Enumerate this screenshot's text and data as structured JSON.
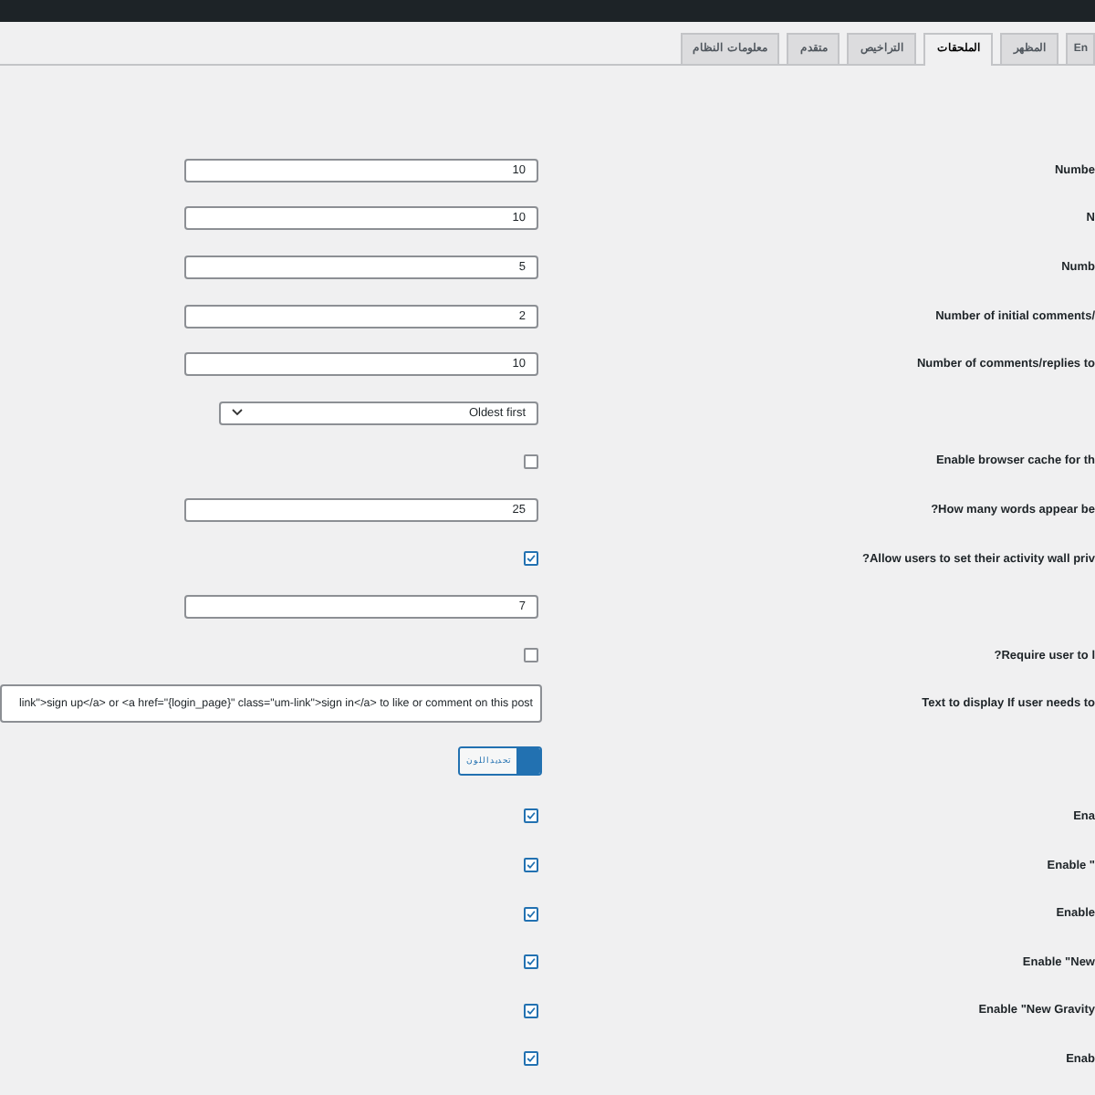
{
  "tabs": [
    {
      "label": "En",
      "selected": false
    },
    {
      "label": "المظهر",
      "selected": false
    },
    {
      "label": "الملحقات",
      "selected": true
    },
    {
      "label": "التراخيص",
      "selected": false
    },
    {
      "label": "متقدم",
      "selected": false
    },
    {
      "label": "معلومات النظام",
      "selected": false
    }
  ],
  "settings": [
    {
      "kind": "number",
      "label": "Numbe",
      "value": "10"
    },
    {
      "kind": "number",
      "label": "N",
      "value": "10"
    },
    {
      "kind": "number",
      "label": "Numb",
      "value": "5"
    },
    {
      "kind": "number",
      "label": "Number of initial comments/",
      "value": "2"
    },
    {
      "kind": "number",
      "label": "Number of comments/replies to",
      "value": "10"
    },
    {
      "kind": "select",
      "value": "Oldest first"
    },
    {
      "kind": "checkbox",
      "label": "Enable browser cache for th",
      "checked": false
    },
    {
      "kind": "number",
      "label": "?How many words appear be",
      "value": "25"
    },
    {
      "kind": "checkbox",
      "label": "?Allow users to set their activity wall priv",
      "checked": true
    },
    {
      "kind": "number",
      "value": "7"
    },
    {
      "kind": "checkbox",
      "label": "?Require user to l",
      "checked": false
    },
    {
      "kind": "textarea",
      "label": "Text to display If user needs to",
      "value": "link\">sign up</a> or <a href=\"{login_page}\" class=\"um-link\">sign in</a> to like or comment on this post"
    },
    {
      "kind": "color",
      "button": "تحديد اللون"
    },
    {
      "kind": "checkbox",
      "label": "Ena",
      "checked": true
    },
    {
      "kind": "checkbox",
      "label": "Enable \"",
      "checked": true
    },
    {
      "kind": "checkbox",
      "label": "Enable",
      "checked": true
    },
    {
      "kind": "checkbox",
      "label": "Enable \"New",
      "checked": true
    },
    {
      "kind": "checkbox",
      "label": "Enable \"New Gravity",
      "checked": true
    },
    {
      "kind": "checkbox",
      "label": "Enab",
      "checked": true
    }
  ]
}
